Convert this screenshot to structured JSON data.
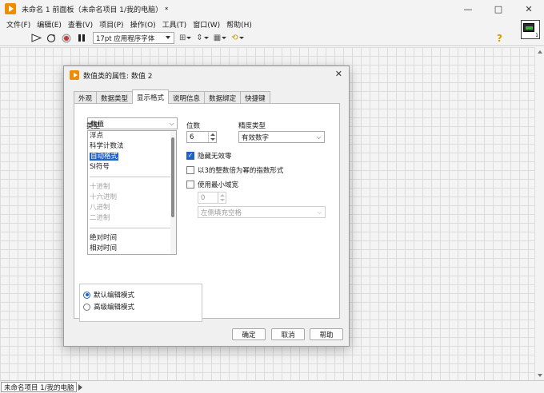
{
  "window": {
    "title": "未命名 1 前面板（未命名项目 1/我的电脑） *",
    "minimize": "—",
    "maximize": "□",
    "close": "✕"
  },
  "menu": [
    "文件(F)",
    "编辑(E)",
    "查看(V)",
    "项目(P)",
    "操作(O)",
    "工具(T)",
    "窗口(W)",
    "帮助(H)"
  ],
  "toolbar": {
    "font": "17pt 应用程序字体",
    "icons": [
      "run-arrow-icon",
      "run-continuously-icon",
      "abort-icon",
      "pause-icon",
      "align-icon",
      "distribute-icon",
      "resize-icon",
      "reorder-icon"
    ],
    "help_symbol": "?",
    "vi_icon_number": "1"
  },
  "status": {
    "path": "未命名项目 1/我的电脑"
  },
  "dialog": {
    "title": "数值类的属性: 数值 2",
    "close": "✕",
    "tabs": [
      "外观",
      "数据类型",
      "显示格式",
      "说明信息",
      "数据绑定",
      "快捷键"
    ],
    "active_tab": 2,
    "format_target": "数值",
    "type_label": "类型",
    "type_list": {
      "group1": [
        "浮点",
        "科学计数法",
        "自动格式",
        "SI符号"
      ],
      "group2": [
        "十进制",
        "十六进制",
        "八进制",
        "二进制"
      ],
      "group3": [
        "绝对时间",
        "相对时间"
      ],
      "selected": "自动格式"
    },
    "digits_label": "位数",
    "digits_value": "6",
    "precision_label": "精度类型",
    "precision_value": "有效数字",
    "checks": {
      "hide_zeros": "隐藏无效零",
      "hide_zeros_checked": true,
      "exponent3": "以3的整数倍为幂的指数形式",
      "exponent3_checked": false,
      "min_width": "使用最小域宽",
      "min_width_checked": false
    },
    "min_width_value": "0",
    "pad_value": "左侧填充空格",
    "modes": {
      "default": "默认编辑模式",
      "advanced": "高级编辑模式",
      "selected": "default"
    },
    "buttons": {
      "ok": "确定",
      "cancel": "取消",
      "help": "帮助"
    }
  }
}
